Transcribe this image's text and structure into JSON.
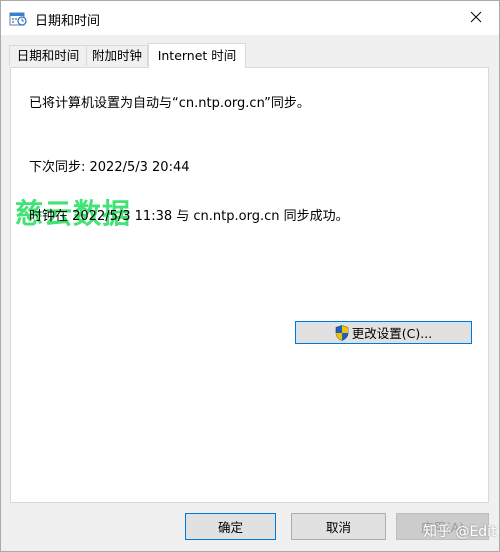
{
  "window": {
    "title": "日期和时间"
  },
  "tabs": [
    {
      "label": "日期和时间"
    },
    {
      "label": "附加时钟"
    },
    {
      "label": "Internet 时间"
    }
  ],
  "panel": {
    "sync_setting": "已将计算机设置为自动与“cn.ntp.org.cn”同步。",
    "next_sync": "下次同步: 2022/5/3 20:44",
    "last_sync_result": "时钟在 2022/5/3 11:38 与 cn.ntp.org.cn 同步成功。",
    "change_settings_label": "更改设置(C)..."
  },
  "watermark": {
    "text": "慈云数据"
  },
  "footer": {
    "ok_label": "确定",
    "cancel_label": "取消",
    "apply_label": "应用(A)"
  },
  "overlay_watermark": {
    "text": "知乎 @Edit"
  },
  "colors": {
    "accent": "#0078d7",
    "watermark_green": "#2ee067",
    "shield_blue": "#1f5fbf",
    "shield_yellow": "#f2c200"
  },
  "icons": {
    "app": "datetime-app-icon",
    "close": "close-icon",
    "shield": "uac-shield-icon"
  }
}
